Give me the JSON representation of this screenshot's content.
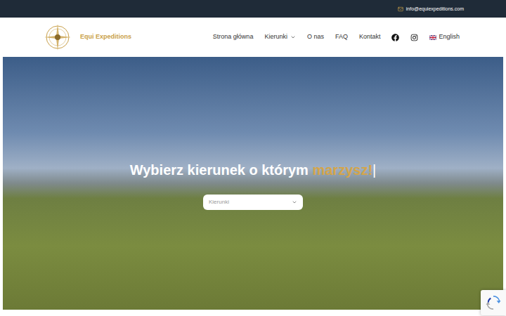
{
  "top_bar": {
    "email": "info@equiexpeditions.com"
  },
  "header": {
    "logo_text": "Equi Expeditions",
    "nav": [
      {
        "label": "Strona główna",
        "kind": "link"
      },
      {
        "label": "Kierunki",
        "kind": "dropdown"
      },
      {
        "label": "O nas",
        "kind": "link"
      },
      {
        "label": "FAQ",
        "kind": "link"
      },
      {
        "label": "Kontakt",
        "kind": "link"
      }
    ],
    "language": "English"
  },
  "hero": {
    "heading": "Wybierz kierunek o którym ",
    "highlight": "marzysz!",
    "cursor": "|",
    "select": {
      "placeholder": "Kierunki"
    }
  }
}
